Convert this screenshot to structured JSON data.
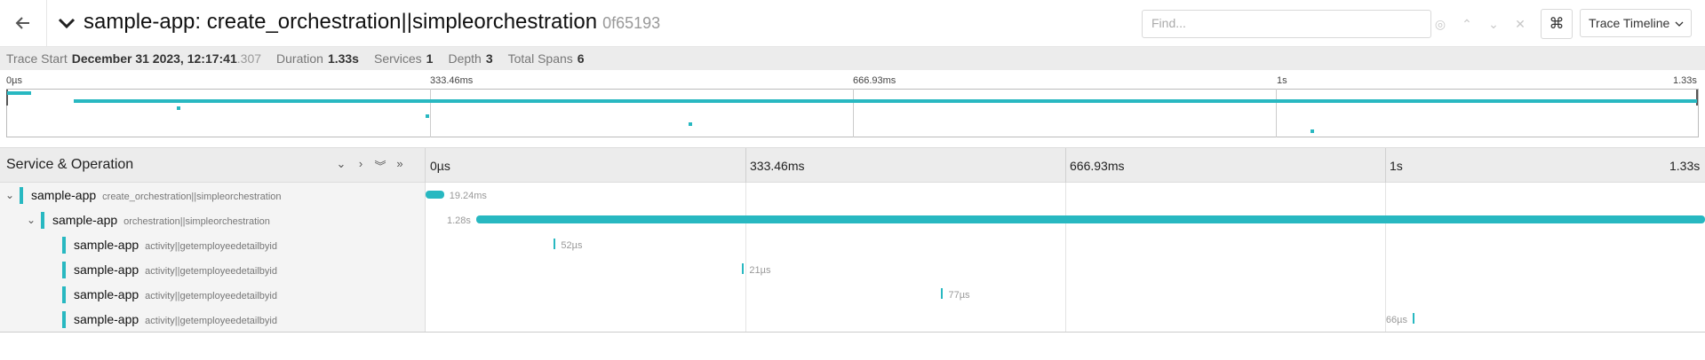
{
  "header": {
    "back_icon": "arrow-left-icon",
    "collapse_icon": "chevron-down-icon",
    "title": "sample-app: create_orchestration||simpleorchestration",
    "trace_id": "0f65193",
    "find_placeholder": "Find...",
    "find_value": "",
    "keyboard_icon": "command-icon",
    "view_label": "Trace Timeline"
  },
  "meta": {
    "trace_start_label": "Trace Start",
    "trace_start_value": "December 31 2023, 12:17:41",
    "trace_start_ms": ".307",
    "duration_label": "Duration",
    "duration_value": "1.33s",
    "services_label": "Services",
    "services_value": "1",
    "depth_label": "Depth",
    "depth_value": "3",
    "total_spans_label": "Total Spans",
    "total_spans_value": "6"
  },
  "minimap": {
    "ticks": [
      "0µs",
      "333.46ms",
      "666.93ms",
      "1s",
      "1.33s"
    ]
  },
  "timeline": {
    "column_title": "Service & Operation",
    "ticks": [
      "0µs",
      "333.46ms",
      "666.93ms",
      "1s",
      "1.33s"
    ]
  },
  "spans": [
    {
      "service": "sample-app",
      "operation": "create_orchestration||simpleorchestration",
      "duration": "19.24ms",
      "depth": 0,
      "has_children": true,
      "start_frac": 0.0,
      "width_frac": 0.0144,
      "label_side": "right"
    },
    {
      "service": "sample-app",
      "operation": "orchestration||simpleorchestration",
      "duration": "1.28s",
      "depth": 1,
      "has_children": true,
      "start_frac": 0.0395,
      "width_frac": 0.9605,
      "label_side": "left"
    },
    {
      "service": "sample-app",
      "operation": "activity||getemployeedetailbyid",
      "duration": "52µs",
      "depth": 2,
      "has_children": false,
      "start_frac": 0.1003,
      "width_frac": 0.0001,
      "label_side": "right"
    },
    {
      "service": "sample-app",
      "operation": "activity||getemployeedetailbyid",
      "duration": "21µs",
      "depth": 2,
      "has_children": false,
      "start_frac": 0.2475,
      "width_frac": 0.0001,
      "label_side": "right"
    },
    {
      "service": "sample-app",
      "operation": "activity||getemployeedetailbyid",
      "duration": "77µs",
      "depth": 2,
      "has_children": false,
      "start_frac": 0.4031,
      "width_frac": 0.0001,
      "label_side": "right"
    },
    {
      "service": "sample-app",
      "operation": "activity||getemployeedetailbyid",
      "duration": "66µs",
      "depth": 2,
      "has_children": false,
      "start_frac": 0.7715,
      "width_frac": 0.0001,
      "label_side": "left"
    }
  ],
  "colors": {
    "span": "#28b8c1"
  }
}
